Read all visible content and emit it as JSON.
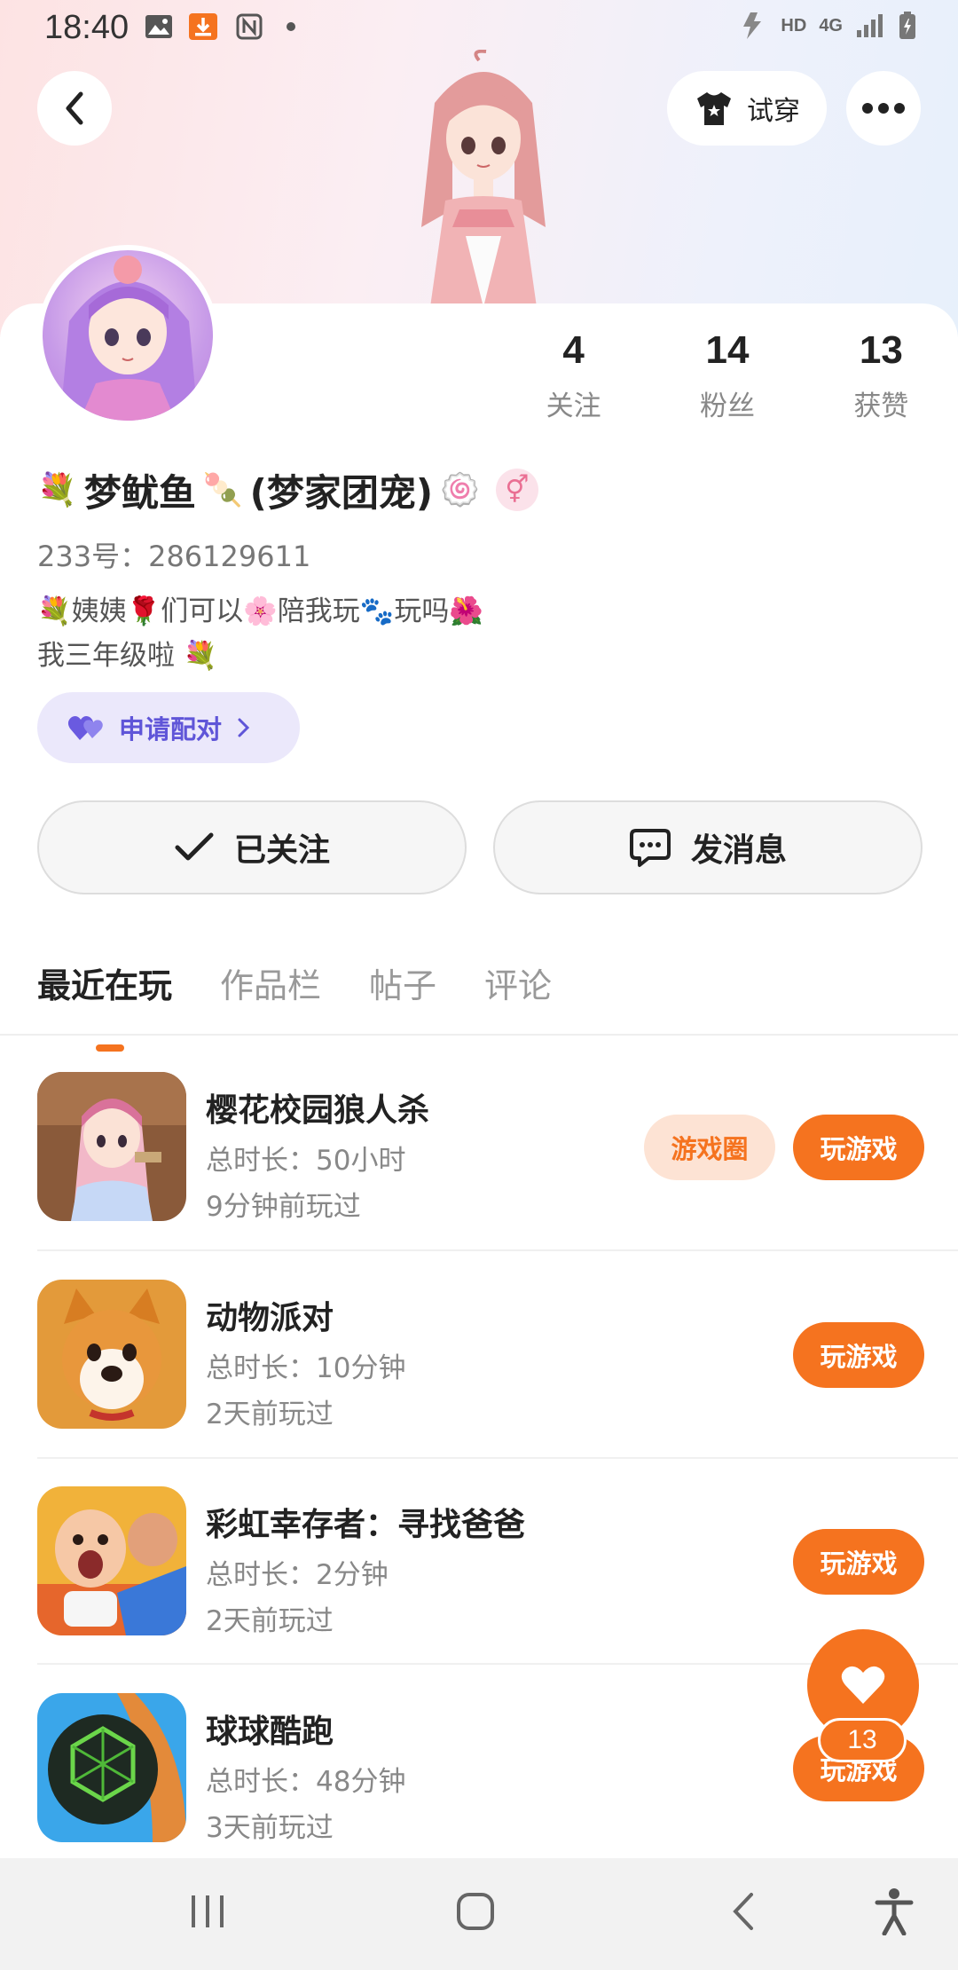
{
  "status_bar": {
    "time": "18:40",
    "hd_label": "HD",
    "network_label": "4G"
  },
  "header": {
    "tryon_label": "试穿"
  },
  "profile": {
    "stats": [
      {
        "value": "4",
        "label": "关注"
      },
      {
        "value": "14",
        "label": "粉丝"
      },
      {
        "value": "13",
        "label": "获赞"
      }
    ],
    "name_prefix_emoji": "💐",
    "name": "梦鱿鱼",
    "name_mid_emoji": "🍡",
    "name_suffix": "(梦家团宠)",
    "name_end_emoji": "🍥",
    "gender_symbol": "⚥",
    "uid": "233号：286129611",
    "bio_line1": "💐姨姨🌹们可以🌸陪我玩🐾玩吗🌺",
    "bio_line2": "我三年级啦 💐",
    "pair_label": "申请配对"
  },
  "actions": {
    "follow_label": "已关注",
    "message_label": "发消息"
  },
  "tabs": [
    {
      "label": "最近在玩",
      "active": true
    },
    {
      "label": "作品栏",
      "active": false
    },
    {
      "label": "帖子",
      "active": false
    },
    {
      "label": "评论",
      "active": false
    }
  ],
  "games": [
    {
      "title": "樱花校园狼人杀",
      "total": "总时长：50小时",
      "recent": "9分钟前玩过",
      "circle_label": "游戏圈",
      "play_label": "玩游戏"
    },
    {
      "title": "动物派对",
      "total": "总时长：10分钟",
      "recent": "2天前玩过",
      "play_label": "玩游戏"
    },
    {
      "title": "彩虹幸存者：寻找爸爸",
      "total": "总时长：2分钟",
      "recent": "2天前玩过",
      "play_label": "玩游戏"
    },
    {
      "title": "球球酷跑",
      "total": "总时长：48分钟",
      "recent": "3天前玩过",
      "play_label": "玩游戏"
    }
  ],
  "like_fab": {
    "count": "13"
  },
  "colors": {
    "accent": "#f5731f",
    "pair": "#5f55d8"
  }
}
